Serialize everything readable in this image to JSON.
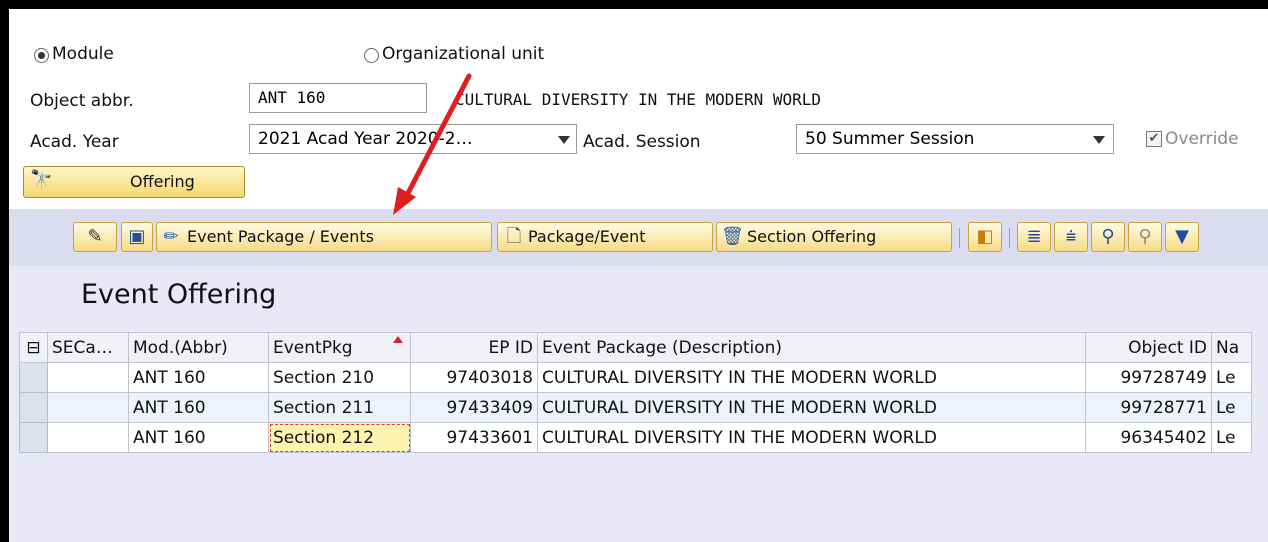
{
  "selection": {
    "module_label": "Module",
    "orgunit_label": "Organizational unit"
  },
  "form": {
    "object_abbr_label": "Object abbr.",
    "object_abbr_value": "ANT 160",
    "object_description": "CULTURAL DIVERSITY IN THE MODERN WORLD",
    "acad_year_label": "Acad. Year",
    "acad_year_value": "2021 Acad Year 2020-2…",
    "acad_session_label": "Acad. Session",
    "acad_session_value": "50 Summer Session",
    "override_label": "Override"
  },
  "offering_button_label": "Offering",
  "toolbar": {
    "event_package_events": "Event Package / Events",
    "package_event": "Package/Event",
    "section_offering": "Section Offering"
  },
  "section_title": "Event Offering",
  "table": {
    "headers": [
      "SECa…",
      "Mod.(Abbr)",
      "EventPkg",
      "EP ID",
      "Event Package (Description)",
      "Object ID",
      "Na"
    ],
    "rows": [
      [
        "",
        "ANT 160",
        "Section 210",
        "97403018",
        "CULTURAL DIVERSITY IN THE MODERN WORLD",
        "99728749",
        "Le"
      ],
      [
        "",
        "ANT 160",
        "Section 211",
        "97433409",
        "CULTURAL DIVERSITY IN THE MODERN WORLD",
        "99728771",
        "Le"
      ],
      [
        "",
        "ANT 160",
        "Section 212",
        "97433601",
        "CULTURAL DIVERSITY IN THE MODERN WORLD",
        "96345402",
        "Le"
      ]
    ]
  },
  "colors": {
    "annotation_arrow": "#e01e1e",
    "toolbar_band": "#dcdcf0",
    "highlight_cell": "#fff3b0"
  }
}
